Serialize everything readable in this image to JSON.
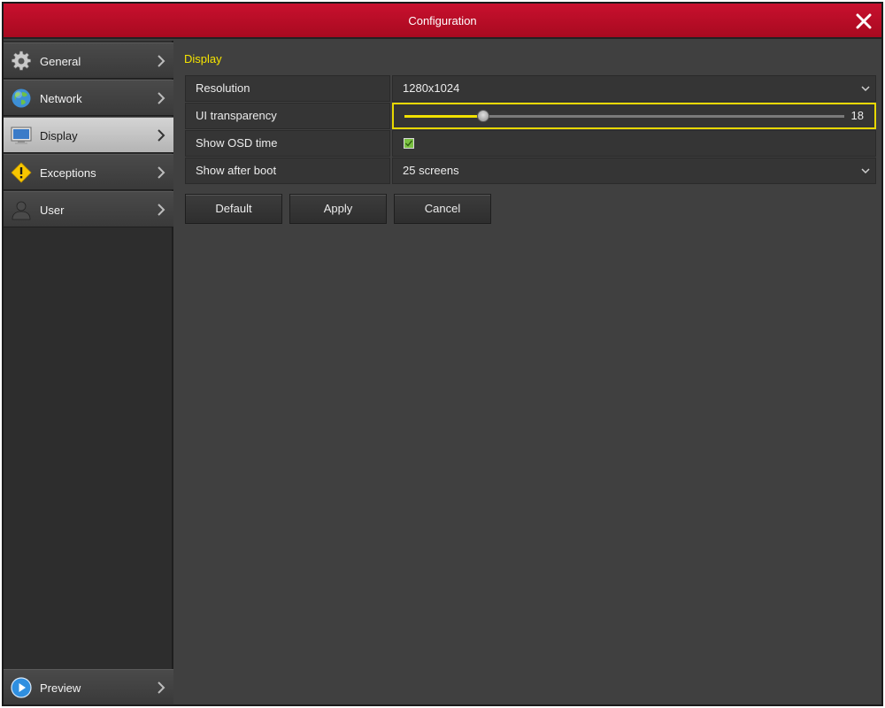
{
  "window": {
    "title": "Configuration"
  },
  "sidebar": {
    "items": [
      {
        "label": "General",
        "icon": "gear-icon"
      },
      {
        "label": "Network",
        "icon": "globe-icon"
      },
      {
        "label": "Display",
        "icon": "monitor-icon",
        "active": true
      },
      {
        "label": "Exceptions",
        "icon": "warning-icon"
      },
      {
        "label": "User",
        "icon": "user-icon"
      }
    ],
    "bottom_item": {
      "label": "Preview",
      "icon": "play-icon"
    }
  },
  "content": {
    "section_title": "Display",
    "rows": [
      {
        "label": "Resolution",
        "value": "1280x1024",
        "type": "select"
      },
      {
        "label": "UI transparency",
        "value": "18",
        "type": "slider",
        "slider_fraction": 0.18
      },
      {
        "label": "Show OSD time",
        "type": "checkbox",
        "checked": true
      },
      {
        "label": "Show after boot",
        "value": "25 screens",
        "type": "select"
      }
    ],
    "buttons": {
      "default_label": "Default",
      "apply_label": "Apply",
      "cancel_label": "Cancel"
    }
  },
  "colors": {
    "title_bar": "#c8102e",
    "accent": "#f0e000",
    "panel_bg": "#404040"
  }
}
